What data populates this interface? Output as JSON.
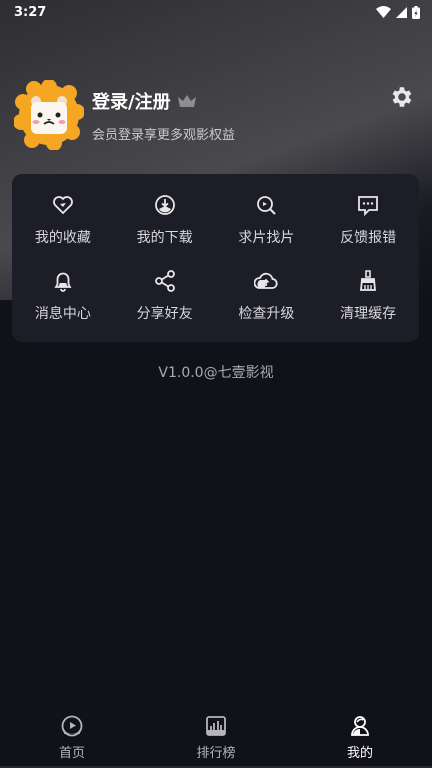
{
  "status_bar": {
    "time": "3:27"
  },
  "profile": {
    "title": "登录/注册",
    "subtitle": "会员登录享更多观影权益",
    "avatar_icon": "lion-avatar",
    "crown_icon": "crown-icon"
  },
  "menu": {
    "items": [
      {
        "label": "我的收藏",
        "icon": "heart-icon"
      },
      {
        "label": "我的下载",
        "icon": "download-icon"
      },
      {
        "label": "求片找片",
        "icon": "search-movie-icon"
      },
      {
        "label": "反馈报错",
        "icon": "feedback-icon"
      },
      {
        "label": "消息中心",
        "icon": "bell-icon"
      },
      {
        "label": "分享好友",
        "icon": "share-icon"
      },
      {
        "label": "检查升级",
        "icon": "upgrade-icon"
      },
      {
        "label": "清理缓存",
        "icon": "broom-icon"
      }
    ]
  },
  "version": "V1.0.0@七壹影视",
  "bottom_nav": {
    "items": [
      {
        "label": "首页",
        "icon": "home-icon"
      },
      {
        "label": "排行榜",
        "icon": "ranking-icon"
      },
      {
        "label": "我的",
        "icon": "profile-icon"
      }
    ],
    "active_index": 2
  },
  "colors": {
    "background": "#111119",
    "card": "#1d1d27",
    "avatar_mane": "#f5a623"
  }
}
